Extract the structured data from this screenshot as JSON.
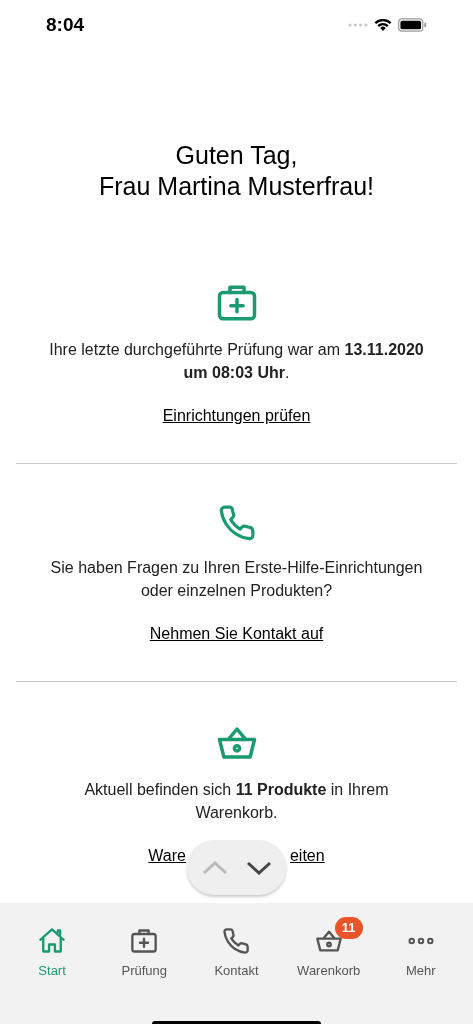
{
  "status_bar": {
    "time": "8:04"
  },
  "greeting": {
    "line_1": "Guten Tag,",
    "line_2": "Frau Martina Musterfrau!"
  },
  "sections": [
    {
      "kind": "kit",
      "text": "Ihre letzte durchgeführte Prüfung war am **13.11.2020 um 08:03 Uhr**.",
      "link_parts": [
        "Einrichtungen prüfen"
      ]
    },
    {
      "kind": "phone",
      "text": "Sie haben Fragen zu Ihren Erste-Hilfe-Einrichtungen oder einzelnen Produkten?",
      "link_parts": [
        "Nehmen Sie Kontakt auf"
      ]
    },
    {
      "kind": "basket",
      "text": "Aktuell befinden sich **11 Produkte** in Ihrem Warenkorb.",
      "link_parts": [
        "Ware",
        "eiten"
      ]
    }
  ],
  "scroll_control": {
    "up_disabled": true,
    "down_disabled": false
  },
  "tab_bar": [
    {
      "kind": "home",
      "label": "Start",
      "selected": true
    },
    {
      "kind": "kit",
      "label": "Prüfung",
      "selected": false
    },
    {
      "kind": "phone",
      "label": "Kontakt",
      "selected": false
    },
    {
      "kind": "basket",
      "label": "Warenkorb",
      "selected": false,
      "badge": "11"
    },
    {
      "kind": "more",
      "label": "Mehr",
      "selected": false
    }
  ]
}
